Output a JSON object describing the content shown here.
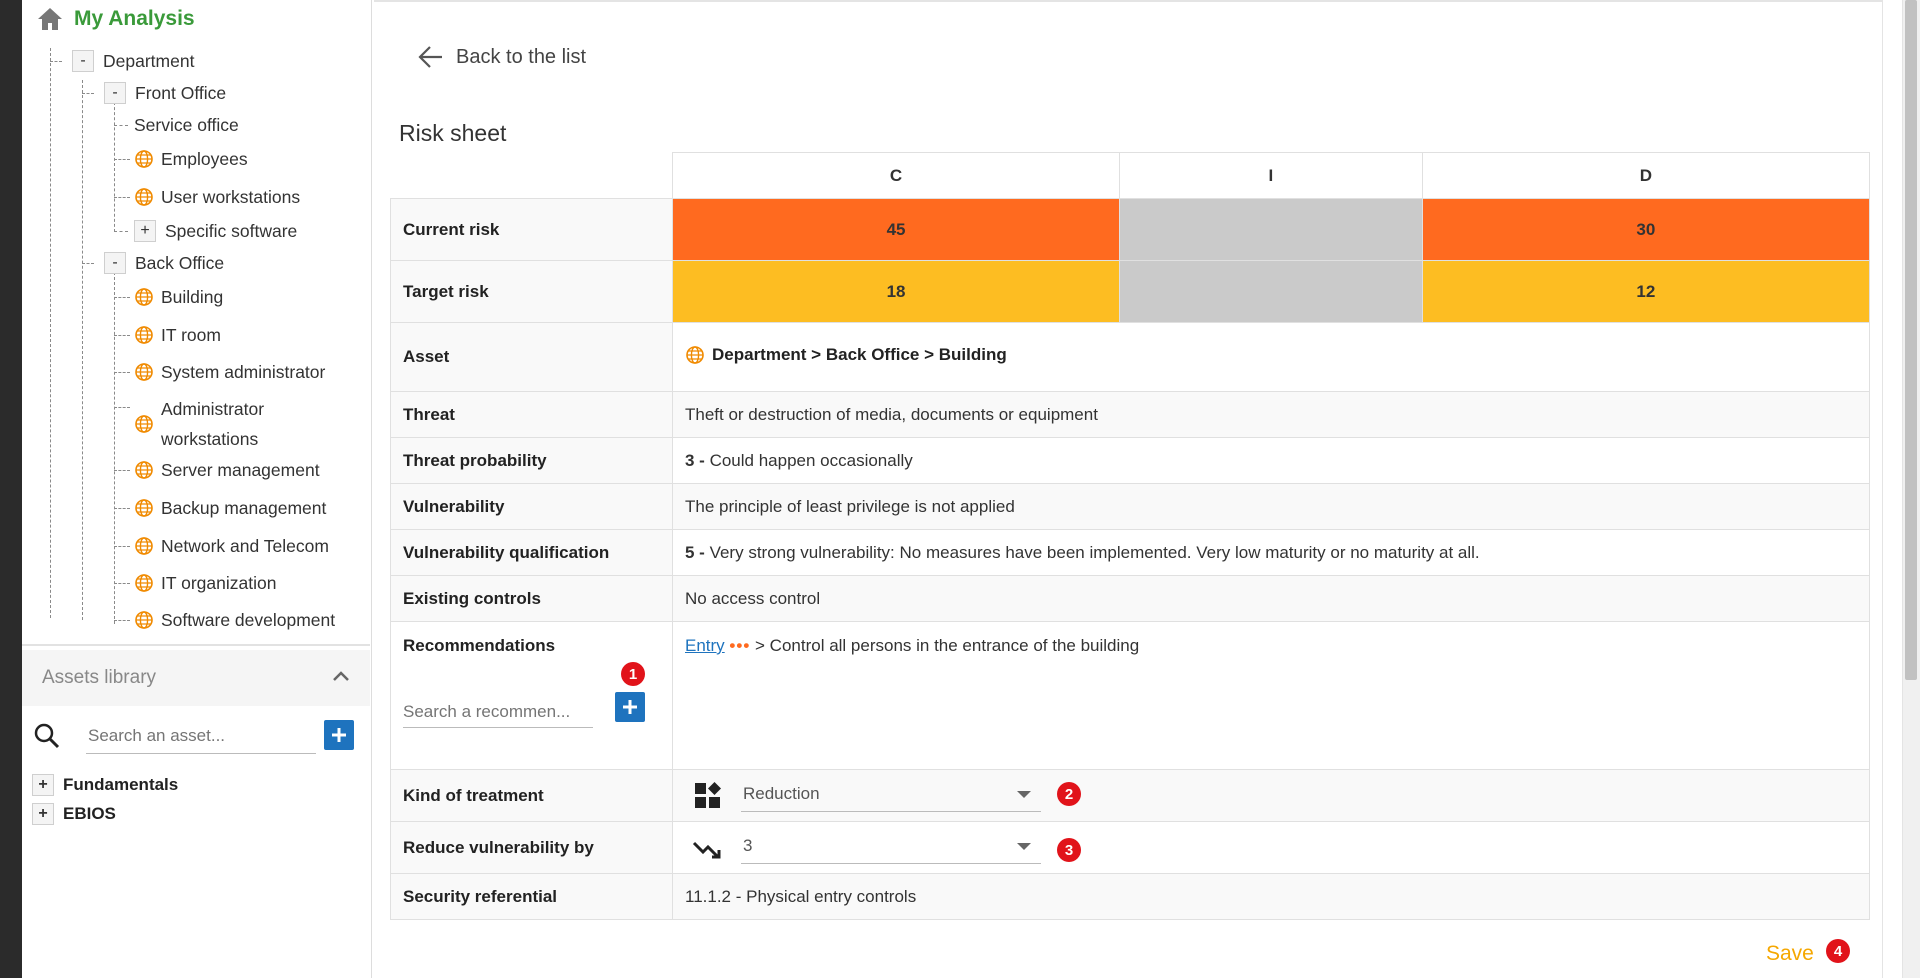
{
  "sidebar": {
    "title": "My Analysis",
    "tree": [
      {
        "label": "Department",
        "toggle": "-"
      },
      {
        "label": "Front Office",
        "toggle": "-"
      },
      {
        "label": "Service office"
      },
      {
        "label": "Employees"
      },
      {
        "label": "User workstations"
      },
      {
        "label": "Specific software",
        "toggle": "+"
      },
      {
        "label": "Back Office",
        "toggle": "-"
      },
      {
        "label": "Building"
      },
      {
        "label": "IT room"
      },
      {
        "label": "System administrator"
      },
      {
        "label": "Administrator",
        "label2": "workstations"
      },
      {
        "label": "Server management"
      },
      {
        "label": "Backup management"
      },
      {
        "label": "Network and Telecom"
      },
      {
        "label": "IT organization"
      },
      {
        "label": "Software development"
      }
    ],
    "library": {
      "title": "Assets library",
      "search_placeholder": "Search an asset...",
      "items": [
        {
          "label": "Fundamentals",
          "toggle": "+"
        },
        {
          "label": "EBIOS",
          "toggle": "+"
        }
      ]
    }
  },
  "main": {
    "back_label": "Back to the list",
    "sheet_title": "Risk sheet",
    "columns": [
      "C",
      "I",
      "D"
    ],
    "current_risk": {
      "label": "Current risk",
      "c": "45",
      "i": "",
      "d": "30"
    },
    "target_risk": {
      "label": "Target risk",
      "c": "18",
      "i": "",
      "d": "12"
    },
    "asset": {
      "label": "Asset",
      "value": "Department > Back Office > Building"
    },
    "threat": {
      "label": "Threat",
      "value": "Theft or destruction of media, documents or equipment"
    },
    "threat_probability": {
      "label": "Threat probability",
      "level": "3 -",
      "value": "Could happen occasionally"
    },
    "vulnerability": {
      "label": "Vulnerability",
      "value": "The principle of least privilege is not applied"
    },
    "vulnerability_qualification": {
      "label": "Vulnerability qualification",
      "level": "5 -",
      "value": "Very strong vulnerability: No measures have been implemented. Very low maturity or no maturity at all."
    },
    "existing_controls": {
      "label": "Existing controls",
      "value": "No access control"
    },
    "recommendations": {
      "label": "Recommendations",
      "search_placeholder": "Search a recommen...",
      "link": "Entry",
      "dots": "•••",
      "text": "> Control all persons in the entrance of the building",
      "badge": "1"
    },
    "kind_of_treatment": {
      "label": "Kind of treatment",
      "value": "Reduction",
      "badge": "2"
    },
    "reduce_vulnerability": {
      "label": "Reduce vulnerability by",
      "value": "3",
      "badge": "3"
    },
    "security_referential": {
      "label": "Security referential",
      "code": "11.1.2 -",
      "value": "Physical entry controls"
    },
    "save_label": "Save",
    "save_badge": "4"
  },
  "colors": {
    "current_risk": "#ff6a1f",
    "target_risk": "#fdbd22",
    "empty_risk": "#cacaca",
    "accent_green": "#3a9a3a",
    "link_blue": "#1e73be",
    "badge_red": "#e1131a",
    "save_orange": "#f5a700"
  }
}
